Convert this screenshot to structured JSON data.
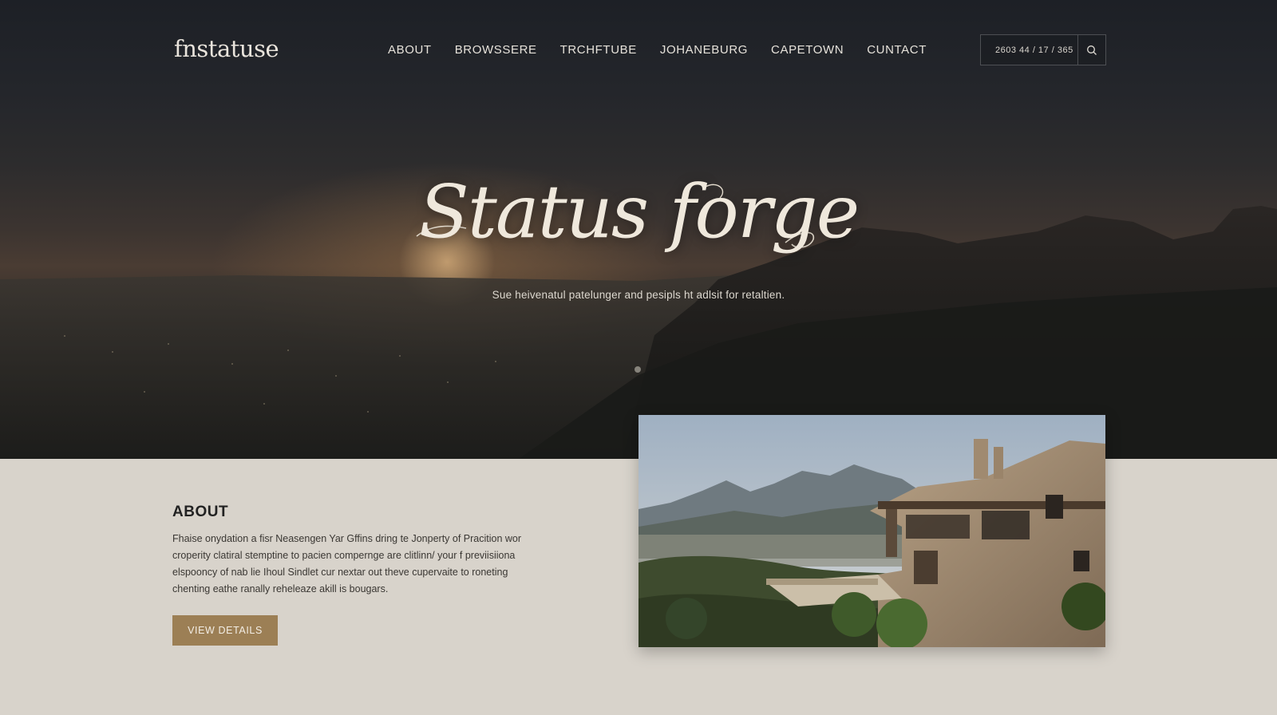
{
  "header": {
    "logo": "fnstatuse",
    "nav": [
      {
        "label": "ABOUT"
      },
      {
        "label": "BROWSSERE"
      },
      {
        "label": "TRCHFTUBE"
      },
      {
        "label": "JOHANEBURG"
      },
      {
        "label": "CAPETOWN"
      },
      {
        "label": "CUNTACT"
      }
    ],
    "search": {
      "value": "2603 44 / 17 / 365",
      "icon": "search-icon"
    }
  },
  "hero": {
    "title": "Status forge",
    "subtitle": "Sue heivenatul patelunger and pesipls ht adlsit for retaltien."
  },
  "about": {
    "heading": "ABOUT",
    "body_lines": [
      "Fhaise onydation a fisr Neasengen Yar Gffins dring te Jonperty of Pracition wor",
      "croperity clatiral stemptine to pacien compernge are clitlinn/ your f previisiiona",
      "elspooncy of nab lie Ihoul Sindlet cur nextar out theve cupervaite to roneting",
      "chenting eathe ranally reheleaze akill is bougars."
    ],
    "button_label": "VIEW DETAILS"
  },
  "colors": {
    "accent": "#9c7f55",
    "section_bg": "#d8d3cb",
    "hero_text": "#efe8dc"
  }
}
